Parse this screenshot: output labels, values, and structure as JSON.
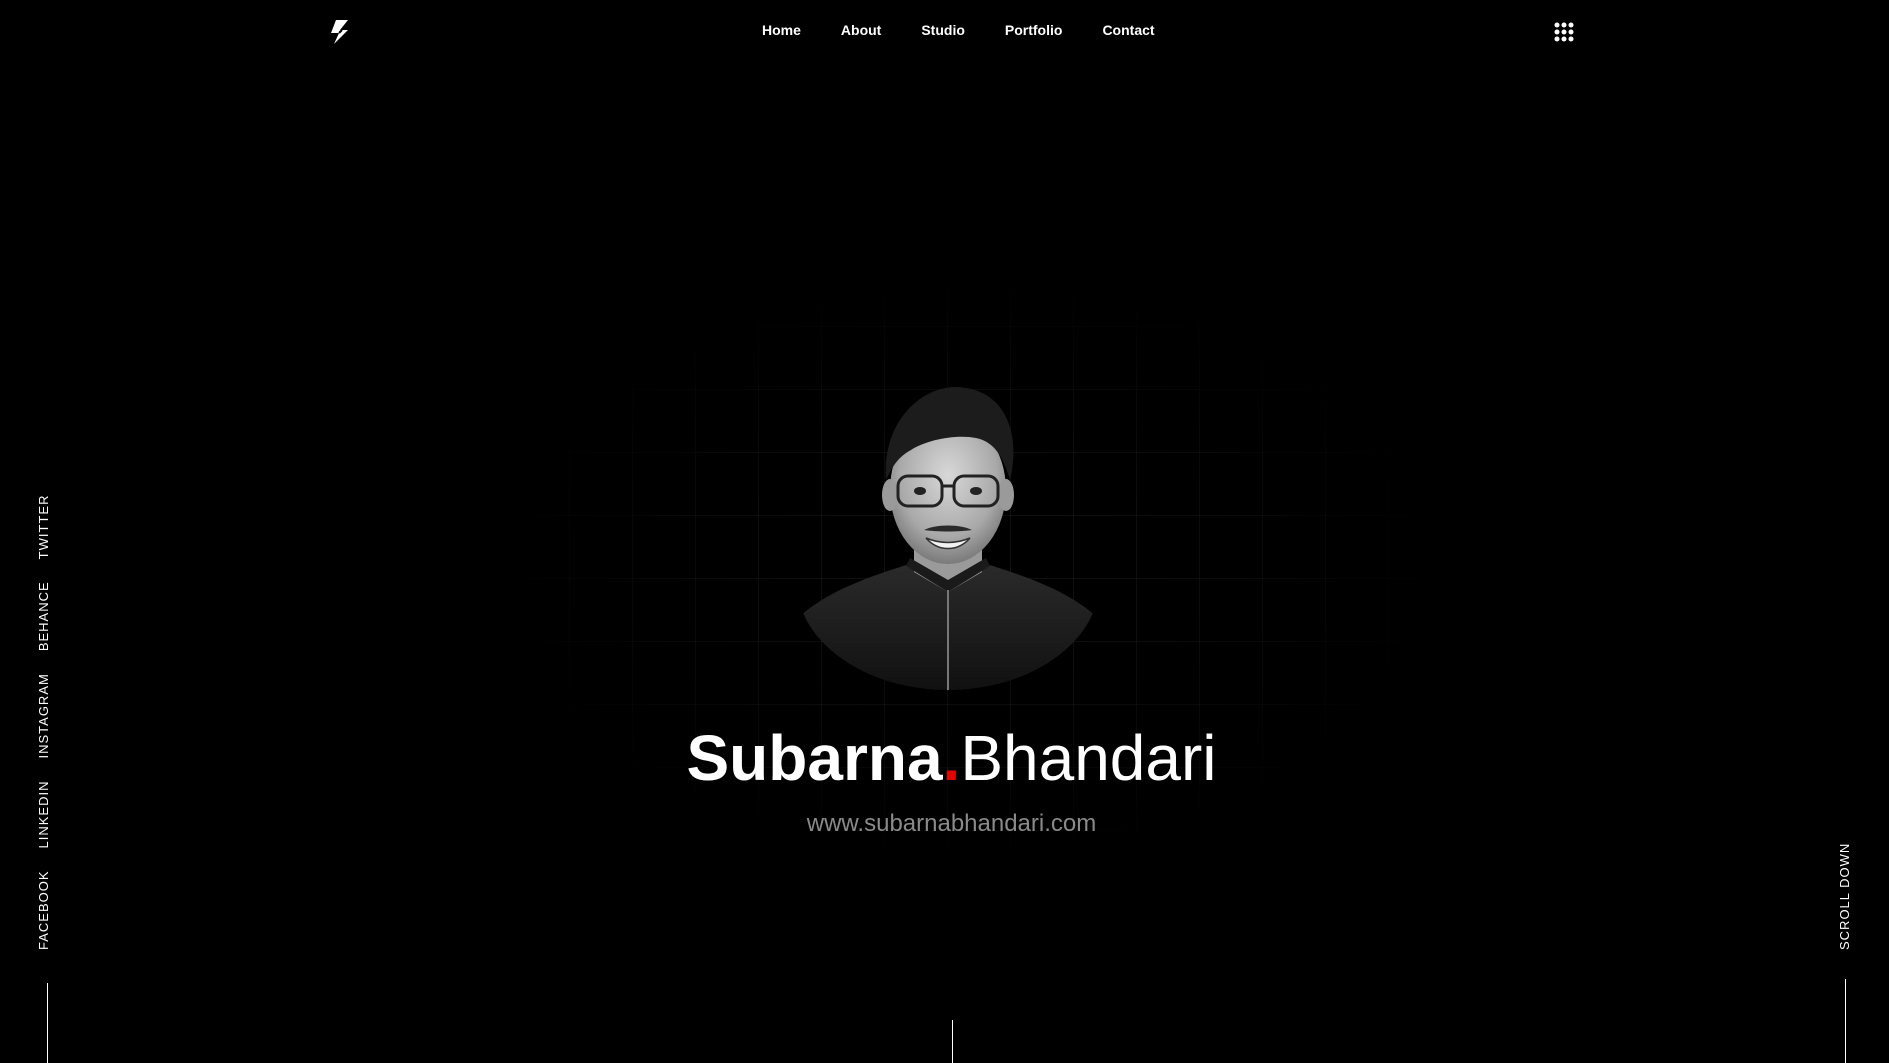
{
  "header": {
    "logo_icon": "lightning-bolt-logo-icon",
    "nav": [
      {
        "label": "Home"
      },
      {
        "label": "About"
      },
      {
        "label": "Studio"
      },
      {
        "label": "Portfolio"
      },
      {
        "label": "Contact"
      }
    ],
    "menu_icon": "grid-dots-icon"
  },
  "social": {
    "items": [
      {
        "label": "FACEBOOK"
      },
      {
        "label": "LINKEDIN"
      },
      {
        "label": "INSTAGRAM"
      },
      {
        "label": "BEHANCE"
      },
      {
        "label": "TWITTER"
      }
    ]
  },
  "hero": {
    "first_name": "Subarna",
    "separator": ".",
    "last_name": "Bhandari",
    "website": "www.subarnabhandari.com",
    "accent_color": "#e10600"
  },
  "scroll": {
    "label": "SCROLL DOWN"
  },
  "colors": {
    "background": "#000000",
    "text": "#ffffff",
    "muted": "#8a8a8a"
  }
}
